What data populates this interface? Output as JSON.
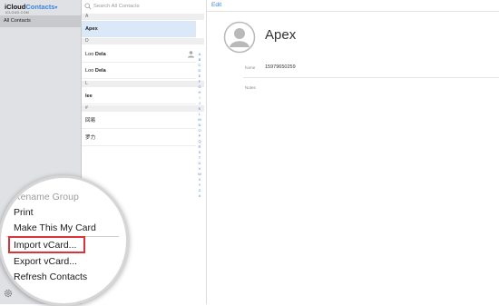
{
  "app": {
    "brand_icloud": "iCloud",
    "brand_contacts": "Contacts",
    "brand_sub": "ICLOUD.COM"
  },
  "sidebar": {
    "groups": [
      {
        "label": "All Contacts"
      }
    ]
  },
  "search": {
    "placeholder": "Search All Contacts"
  },
  "list": {
    "sections": [
      {
        "letter": "A",
        "contacts": [
          {
            "first": "",
            "last": "Apex",
            "selected": true
          }
        ]
      },
      {
        "letter": "D",
        "contacts": [
          {
            "first": "Loo",
            "last": "Dela"
          },
          {
            "first": "Loo",
            "last": "Dela"
          }
        ]
      },
      {
        "letter": "L",
        "contacts": [
          {
            "first": "",
            "last": "lee"
          }
        ]
      },
      {
        "letter": "#",
        "contacts": [
          {
            "first": "",
            "last": "回易"
          },
          {
            "first": "",
            "last": "罗力"
          }
        ]
      }
    ],
    "index": [
      "A",
      "B",
      "C",
      "D",
      "E",
      "F",
      "G",
      "H",
      "I",
      "J",
      "K",
      "L",
      "M",
      "N",
      "O",
      "P",
      "Q",
      "R",
      "S",
      "T",
      "U",
      "V",
      "W",
      "X",
      "Y",
      "Z",
      "#"
    ]
  },
  "detail": {
    "edit_label": "Edit",
    "name": "Apex",
    "phone_label": "home",
    "phone_value": "15979650259",
    "notes_label": "Notes"
  },
  "menu": {
    "items": [
      "Rename Group",
      "Print",
      "Make This My Card",
      "Import vCard...",
      "Export vCard...",
      "Refresh Contacts"
    ],
    "highlighted": "Import vCard..."
  },
  "colors": {
    "accent": "#3a86e0",
    "selection": "#dbe8f8",
    "highlight_box": "#d8343a",
    "sidebar": "#dfe1e4"
  },
  "icons": {
    "search": "search-icon",
    "avatar": "person-silhouette-icon",
    "settings": "gear-icon",
    "card": "person-card-icon"
  }
}
